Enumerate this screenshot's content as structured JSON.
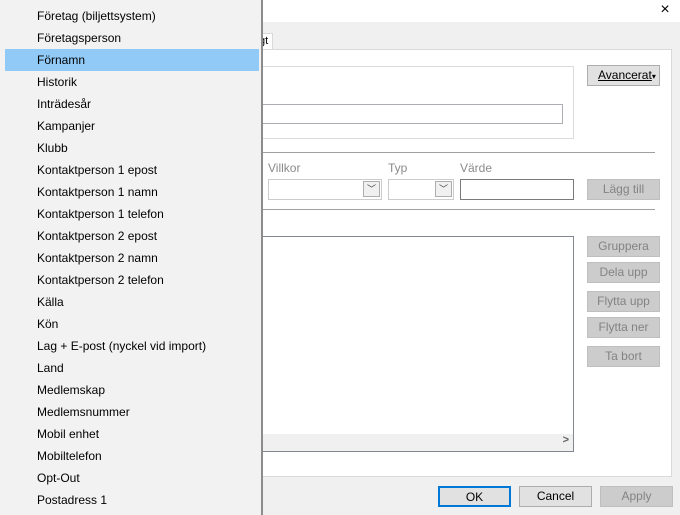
{
  "dialog": {
    "tab_label": "gt",
    "advanced_label": "Avancerat",
    "condition_label": "Villkor",
    "type_label": "Typ",
    "value_label": "Värde",
    "add_label": "Lägg till",
    "side_buttons": [
      "Gruppera",
      "Dela upp",
      "Flytta upp",
      "Flytta ner",
      "Ta bort"
    ],
    "ok_label": "OK",
    "cancel_label": "Cancel",
    "apply_label": "Apply",
    "close_icon": "×",
    "scroll_right_icon": ">"
  },
  "menu": {
    "selected": "Förnamn",
    "items": [
      "Företag (biljettsystem)",
      "Företagsperson",
      "Förnamn",
      "Historik",
      "Inträdesår",
      "Kampanjer",
      "Klubb",
      "Kontaktperson 1 epost",
      "Kontaktperson 1 namn",
      "Kontaktperson 1 telefon",
      "Kontaktperson 2 epost",
      "Kontaktperson 2 namn",
      "Kontaktperson 2 telefon",
      "Källa",
      "Kön",
      "Lag + E-post (nyckel vid import)",
      "Land",
      "Medlemskap",
      "Medlemsnummer",
      "Mobil enhet",
      "Mobiltelefon",
      "Opt-Out",
      "Postadress 1"
    ]
  },
  "colors": {
    "highlight": "#91c9f7",
    "focus": "#0078d7"
  }
}
